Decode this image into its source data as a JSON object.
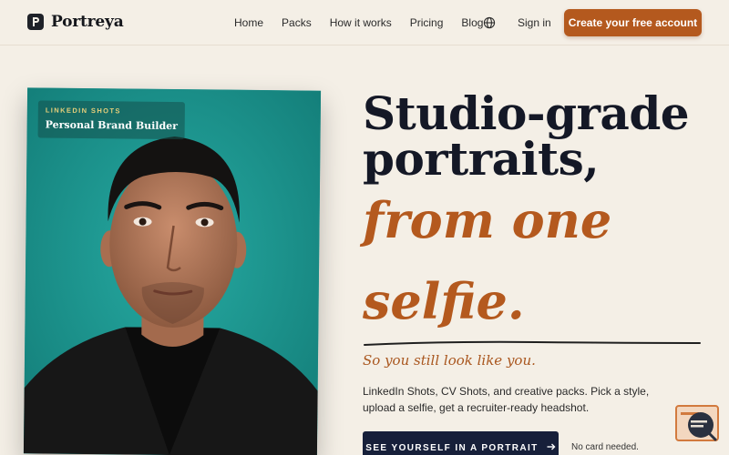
{
  "brand": {
    "name": "Portreya",
    "icon": "portreya-logo-icon"
  },
  "nav": {
    "links": [
      "Home",
      "Packs",
      "How it works",
      "Pricing",
      "Blog"
    ],
    "language_icon": "globe-icon",
    "signin": "Sign in",
    "cta": "Create your free account"
  },
  "portrait": {
    "kicker": "LINKEDIN SHOTS",
    "title": "Personal Brand Builder"
  },
  "hero": {
    "line1": "Studio-grade",
    "line2": "portraits,",
    "italic1": "from one",
    "italic2": "selfie.",
    "tagline": "So you still look like you.",
    "description": "LinkedIn Shots, CV Shots, and creative packs. Pick a style, upload a selfie, get a recruiter-ready headshot.",
    "primary_button": "SEE YOURSELF IN A PORTRAIT",
    "primary_button_icon": "arrow-right-icon",
    "note": "No card needed."
  },
  "widget_icon": "chat-support-icon",
  "colors": {
    "background": "#f4efe6",
    "accent": "#b4591e",
    "navy": "#17203a",
    "portrait_bg": "#1e9a93"
  }
}
